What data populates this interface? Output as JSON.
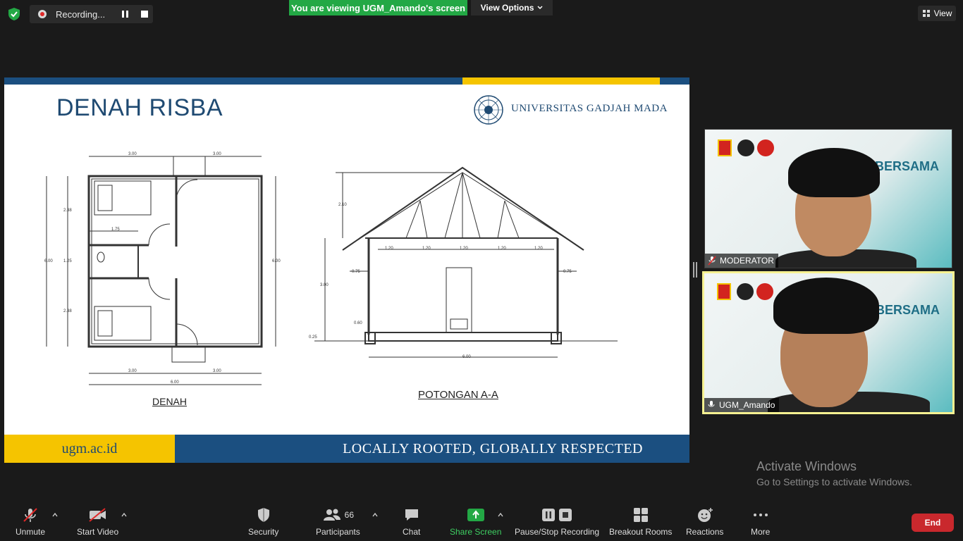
{
  "recording": {
    "status": "Recording..."
  },
  "share_banner": {
    "text": "You are viewing UGM_Amando's screen",
    "view_options": "View Options"
  },
  "view_button": {
    "label": "View"
  },
  "slide": {
    "title": "DENAH RISBA",
    "university": "UNIVERSITAS GADJAH MADA",
    "caption_plan": "DENAH",
    "caption_section": "POTONGAN A-A",
    "footer_url": "ugm.ac.id",
    "footer_slogan": "LOCALLY ROOTED, GLOBALLY RESPECTED"
  },
  "participants": {
    "moderator": {
      "name": "MODERATOR",
      "banner": "EMI BERSAMA"
    },
    "presenter": {
      "name": "UGM_Amando",
      "banner": "EMI BERSAMA"
    }
  },
  "watermark": {
    "line1": "Activate Windows",
    "line2": "Go to Settings to activate Windows."
  },
  "toolbar": {
    "unmute": "Unmute",
    "start_video": "Start Video",
    "security": "Security",
    "participants": "Participants",
    "participants_count": "66",
    "chat": "Chat",
    "share_screen": "Share Screen",
    "pause_stop": "Pause/Stop Recording",
    "breakout": "Breakout Rooms",
    "reactions": "Reactions",
    "more": "More",
    "end": "End"
  },
  "colors": {
    "share_green": "#23a845",
    "end_red": "#c9282d",
    "ugm_blue": "#1b4f80",
    "ugm_yellow": "#f5c400",
    "active_speaker": "#f6f191"
  }
}
